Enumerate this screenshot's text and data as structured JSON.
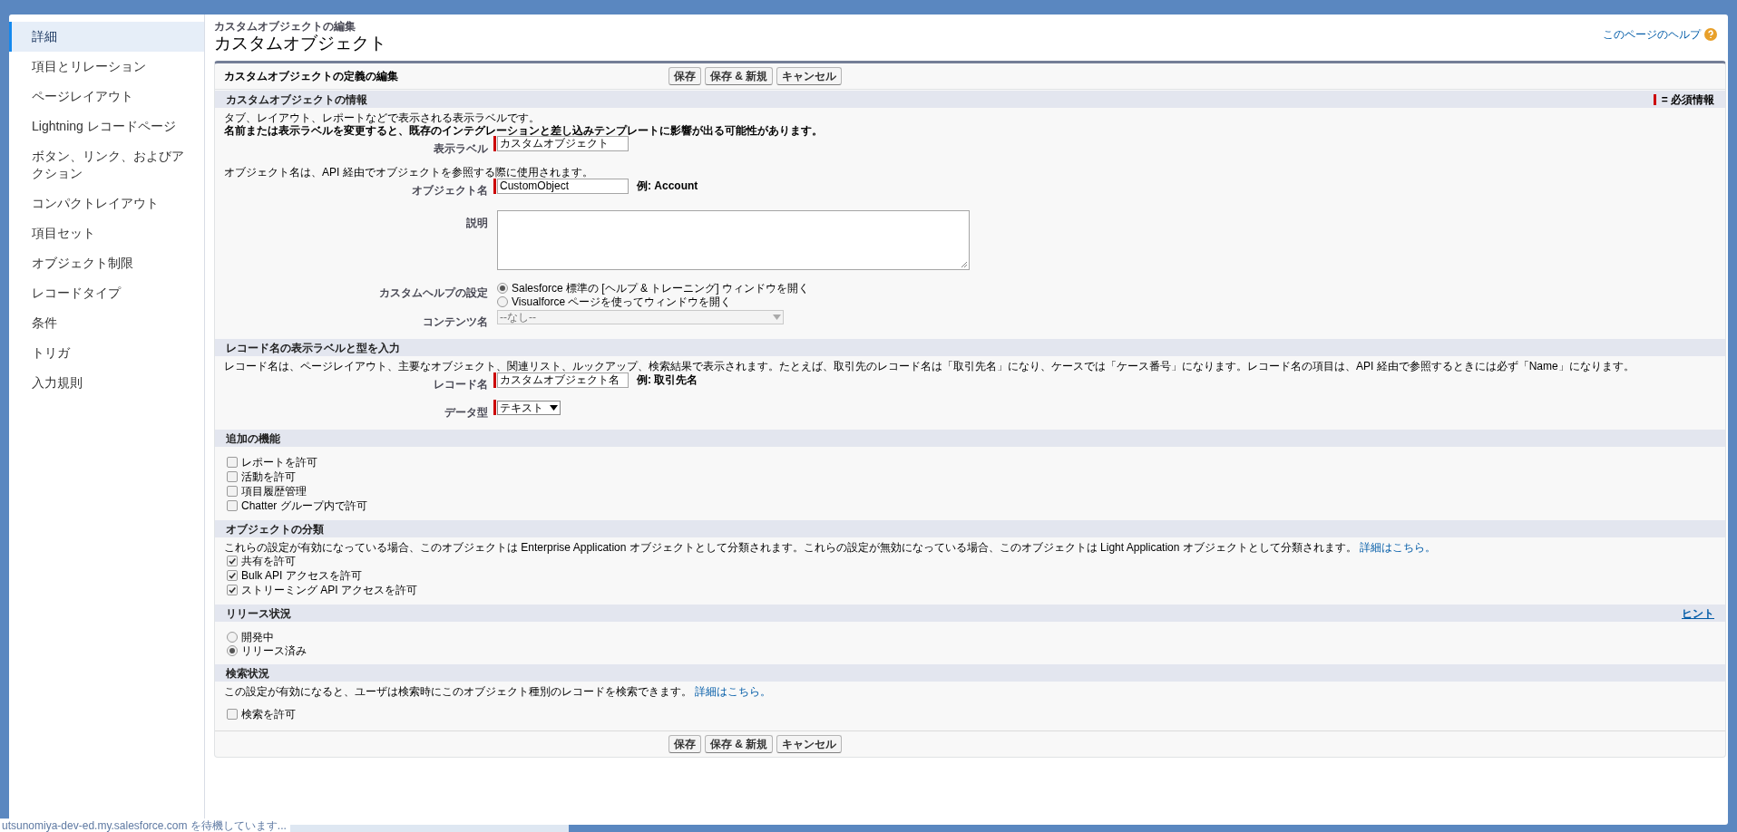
{
  "sidebar": {
    "items": [
      {
        "label": "詳細",
        "selected": true
      },
      {
        "label": "項目とリレーション",
        "selected": false
      },
      {
        "label": "ページレイアウト",
        "selected": false
      },
      {
        "label": "Lightning レコードページ",
        "selected": false
      },
      {
        "label": "ボタン、リンク、およびアクション",
        "selected": false
      },
      {
        "label": "コンパクトレイアウト",
        "selected": false
      },
      {
        "label": "項目セット",
        "selected": false
      },
      {
        "label": "オブジェクト制限",
        "selected": false
      },
      {
        "label": "レコードタイプ",
        "selected": false
      },
      {
        "label": "条件",
        "selected": false
      },
      {
        "label": "トリガ",
        "selected": false
      },
      {
        "label": "入力規則",
        "selected": false
      }
    ]
  },
  "header": {
    "subtitle": "カスタムオブジェクトの編集",
    "title": "カスタムオブジェクト",
    "help_link": "このページのヘルプ"
  },
  "form": {
    "title": "カスタムオブジェクトの定義の編集",
    "buttons": [
      "保存",
      "保存 & 新規",
      "キャンセル"
    ],
    "sections": [
      {
        "title": "カスタムオブジェクトの情報",
        "legend": "= 必須情報",
        "rows": [
          {
            "kind": "note",
            "text": "タブ、レイアウト、レポートなどで表示される表示ラベルです。"
          },
          {
            "kind": "warning",
            "text": "名前または表示ラベルを変更すると、既存のインテグレーションと差し込みテンプレートに影響が出る可能性があります。"
          },
          {
            "kind": "text_field",
            "label": "表示ラベル",
            "value": "カスタムオブジェクト",
            "required": true
          },
          {
            "kind": "note",
            "text": "オブジェクト名は、API 経由でオブジェクトを参照する際に使用されます。"
          },
          {
            "kind": "text_field",
            "label": "オブジェクト名",
            "value": "CustomObject",
            "required": true,
            "example": "例:  Account"
          },
          {
            "kind": "textarea",
            "label": "説明"
          },
          {
            "kind": "radio_group",
            "label": "カスタムヘルプの設定",
            "options": [
              {
                "label": "Salesforce 標準の [ヘルプ & トレーニング] ウィンドウを開く",
                "selected": true
              },
              {
                "label": "Visualforce ページを使ってウィンドウを開く",
                "selected": false
              }
            ]
          },
          {
            "kind": "select",
            "label": "コンテンツ名",
            "value": "--なし--",
            "disabled": true
          }
        ]
      },
      {
        "title": "レコード名の表示ラベルと型を入力",
        "rows": [
          {
            "kind": "note",
            "text": "レコード名は、ページレイアウト、主要なオブジェクト、関連リスト、ルックアップ、検索結果で表示されます。たとえば、取引先のレコード名は「取引先名」になり、ケースでは「ケース番号」になります。レコード名の項目は、API 経由で参照するときには必ず「Name」になります。"
          },
          {
            "kind": "text_field",
            "label": "レコード名",
            "value": "カスタムオブジェクト名",
            "required": true,
            "example": "例:  取引先名"
          },
          {
            "kind": "select",
            "label": "データ型",
            "value": "テキスト",
            "required": true,
            "disabled": false
          }
        ]
      },
      {
        "title": "追加の機能",
        "rows": [
          {
            "kind": "checkbox",
            "label": "レポートを許可",
            "checked": false
          },
          {
            "kind": "checkbox",
            "label": "活動を許可",
            "checked": false
          },
          {
            "kind": "checkbox",
            "label": "項目履歴管理",
            "checked": false
          },
          {
            "kind": "checkbox",
            "label": "Chatter グループ内で許可",
            "checked": false
          }
        ]
      },
      {
        "title": "オブジェクトの分類",
        "rows": [
          {
            "kind": "note",
            "text": "これらの設定が有効になっている場合、このオブジェクトは Enterprise Application オブジェクトとして分類されます。これらの設定が無効になっている場合、このオブジェクトは Light Application オブジェクトとして分類されます。",
            "link": "詳細はこちら。"
          },
          {
            "kind": "checkbox",
            "label": "共有を許可",
            "checked": true
          },
          {
            "kind": "checkbox",
            "label": "Bulk API アクセスを許可",
            "checked": true
          },
          {
            "kind": "checkbox",
            "label": "ストリーミング API アクセスを許可",
            "checked": true
          }
        ]
      },
      {
        "title": "リリース状況",
        "link": "ヒント",
        "rows": [
          {
            "kind": "radio",
            "label": "開発中",
            "selected": false
          },
          {
            "kind": "radio",
            "label": "リリース済み",
            "selected": true
          }
        ]
      },
      {
        "title": "検索状況",
        "rows": [
          {
            "kind": "note",
            "text": "この設定が有効になると、ユーザは検索時にこのオブジェクト種別のレコードを検索できます。",
            "link": "詳細はこちら。"
          },
          {
            "kind": "checkbox",
            "label": "検索を許可",
            "checked": false
          }
        ]
      }
    ]
  },
  "bottom_buttons": [
    "保存",
    "保存 & 新規",
    "キャンセル"
  ],
  "status_text": "utsunomiya-dev-ed.my.salesforce.com を待機しています..."
}
